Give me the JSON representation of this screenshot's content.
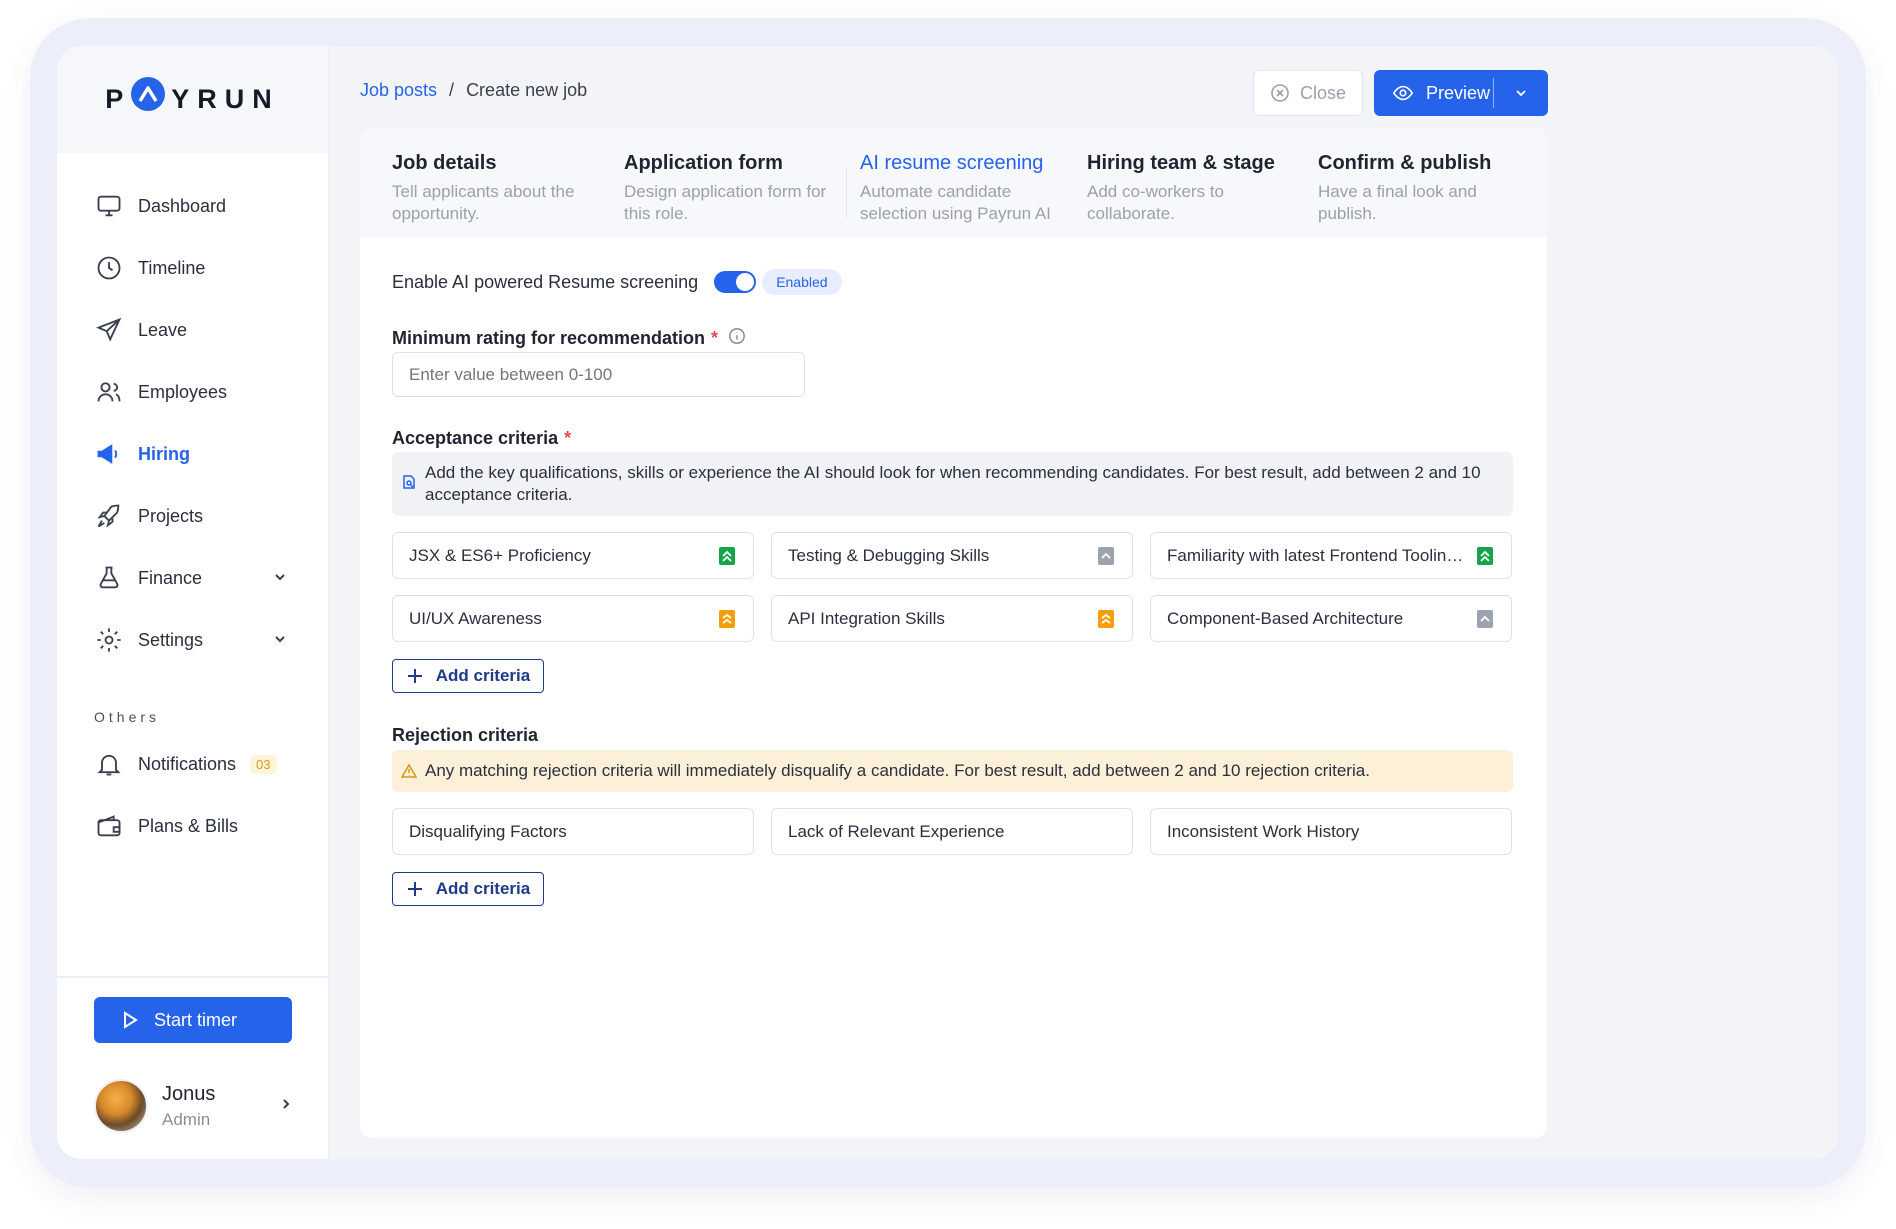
{
  "brand": {
    "name_left": "P",
    "name_right": "YRUN",
    "accent": "#2563eb"
  },
  "sidebar": {
    "items": [
      {
        "label": "Dashboard",
        "icon": "monitor-icon"
      },
      {
        "label": "Timeline",
        "icon": "clock-icon"
      },
      {
        "label": "Leave",
        "icon": "plane-icon"
      },
      {
        "label": "Employees",
        "icon": "users-icon"
      },
      {
        "label": "Hiring",
        "icon": "megaphone-icon",
        "active": true
      },
      {
        "label": "Projects",
        "icon": "rocket-icon"
      },
      {
        "label": "Finance",
        "icon": "flask-icon",
        "expandable": true
      },
      {
        "label": "Settings",
        "icon": "gear-icon",
        "expandable": true
      }
    ],
    "others_label": "Others",
    "others": [
      {
        "label": "Notifications",
        "icon": "bell-icon",
        "badge": "03"
      },
      {
        "label": "Plans & Bills",
        "icon": "wallet-icon"
      }
    ],
    "timer_label": "Start timer",
    "user": {
      "name": "Jonus",
      "role": "Admin"
    }
  },
  "topbar": {
    "breadcrumb": {
      "parent": "Job posts",
      "separator": "/",
      "current": "Create new job"
    },
    "close_label": "Close",
    "preview_label": "Preview"
  },
  "steps": [
    {
      "title": "Job details",
      "desc": "Tell applicants about the opportunity."
    },
    {
      "title": "Application form",
      "desc": "Design application form for this role."
    },
    {
      "title": "AI resume screening",
      "desc": "Automate candidate selection using Payrun AI",
      "active": true
    },
    {
      "title": "Hiring team & stage",
      "desc": "Add co-workers to collaborate."
    },
    {
      "title": "Confirm & publish",
      "desc": "Have a final look and publish."
    }
  ],
  "form": {
    "enable_label": "Enable AI powered Resume screening",
    "enable_state": "Enabled",
    "min_rating_label": "Minimum rating for recommendation",
    "required_mark": "*",
    "min_rating_placeholder": "Enter value between 0-100",
    "acceptance_label": "Acceptance criteria",
    "acceptance_note": "Add the key qualifications, skills or experience the AI should look for when recommending candidates. For best result, add between 2 and 10 acceptance criteria.",
    "acceptance": [
      {
        "text": "JSX & ES6+ Proficiency",
        "priority": "high"
      },
      {
        "text": "Testing & Debugging Skills",
        "priority": "low"
      },
      {
        "text": "Familiarity with latest Frontend Tooling T...",
        "priority": "high"
      },
      {
        "text": "UI/UX Awareness",
        "priority": "medium"
      },
      {
        "text": "API Integration Skills",
        "priority": "medium"
      },
      {
        "text": "Component-Based Architecture",
        "priority": "low"
      }
    ],
    "add_criteria_label": "Add criteria",
    "rejection_label": "Rejection criteria",
    "rejection_note": "Any matching rejection criteria will immediately disqualify a candidate. For best result, add between 2 and 10 rejection criteria.",
    "rejection": [
      {
        "text": "Disqualifying Factors"
      },
      {
        "text": "Lack of Relevant Experience"
      },
      {
        "text": "Inconsistent Work History"
      }
    ]
  },
  "colors": {
    "priority_high": "#16a34a",
    "priority_medium": "#f59e0b",
    "priority_low": "#9ca3af",
    "warning_bg": "#fdf0d8"
  }
}
